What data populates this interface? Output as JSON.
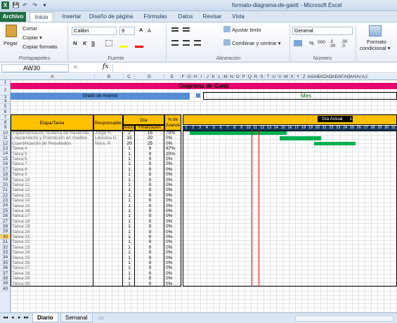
{
  "window": {
    "title": "formato-diagrama-de-gantt - Microsoft Excel"
  },
  "qat": {
    "logo": "X",
    "save": "💾",
    "undo": "↶",
    "redo": "↷",
    "more": "▾"
  },
  "ribbon_tabs": [
    "Archivo",
    "Inicio",
    "Insertar",
    "Diseño de página",
    "Fórmulas",
    "Datos",
    "Revisar",
    "Vista"
  ],
  "ribbon": {
    "paste": "Pegar",
    "cut": "Cortar",
    "copy": "Copiar ▾",
    "copy_format": "Copiar formato",
    "font_name": "Calibri",
    "font_size": "9",
    "wrap_text": "Ajustar texto",
    "merge_center": "Combinar y centrar ▾",
    "number_format": "General",
    "cond_format_1": "Formato",
    "cond_format_2": "condicional ▾",
    "group_clipboard": "Portapapeles",
    "group_font": "Fuente",
    "group_alignment": "Alineación",
    "group_number": "Número",
    "bold": "N",
    "italic": "K",
    "underline": "S",
    "grow_font": "A",
    "shrink_font": "A",
    "percent": "%",
    "thousands": "000",
    "dec_more": ",0 .00",
    "dec_less": ",00 ,0"
  },
  "formula_bar": {
    "name_box": "AW30",
    "fx": "fx",
    "value": ""
  },
  "columns": [
    "A",
    "B",
    "C",
    "D",
    "E",
    "F",
    "G",
    "H",
    "I",
    "J",
    "K",
    "L",
    "M",
    "N",
    "O",
    "P",
    "Q",
    "R",
    "S",
    "T",
    "U",
    "V",
    "W",
    "X",
    "Y",
    "Z",
    "AA",
    "AB",
    "AC",
    "AD",
    "AE",
    "AF",
    "AG",
    "AH",
    "AI",
    "AJ"
  ],
  "rows": [
    "1",
    "2",
    "3",
    "4",
    "5",
    "6",
    "7",
    "8",
    "9",
    "10",
    "11",
    "12",
    "13",
    "14",
    "15",
    "16",
    "17",
    "18",
    "19",
    "20",
    "21",
    "22",
    "23",
    "24",
    "25",
    "26",
    "27",
    "28",
    "29",
    "30",
    "31",
    "32",
    "33",
    "34",
    "35",
    "36",
    "37",
    "38",
    "39",
    "40"
  ],
  "sheet": {
    "title": "Diagrama de Gantt",
    "progress_label": "Grado de Avance",
    "month_label": "Mes",
    "col_task": "Etapa/Tarea",
    "col_owner": "Responsable",
    "col_day": "Día",
    "col_start": "Inicio",
    "col_end": "Finalización",
    "col_pct": "% de Avance",
    "current_day_label": "Día Actual",
    "current_day_value": "11",
    "days": [
      "1",
      "2",
      "3",
      "4",
      "5",
      "6",
      "7",
      "8",
      "9",
      "10",
      "11",
      "12",
      "13",
      "14",
      "15",
      "16",
      "17",
      "18",
      "19",
      "20",
      "21",
      "22",
      "23",
      "24",
      "25",
      "26",
      "27",
      "28",
      "29",
      "30",
      "31"
    ],
    "tasks": [
      {
        "name": "Implementación Sistema de Reservas",
        "owner": "Jorge R.",
        "start": "2",
        "end": "15",
        "pct": "70%"
      },
      {
        "name": "Lnazamiento y Promoción en medios",
        "owner": "Leonora G.",
        "start": "15",
        "end": "20",
        "pct": "0%"
      },
      {
        "name": "Cuantificación de Resultados",
        "owner": "Nora. R",
        "start": "20",
        "end": "25",
        "pct": "0%"
      },
      {
        "name": "Tarea 4",
        "owner": "",
        "start": "1",
        "end": "0",
        "pct": "67%"
      },
      {
        "name": "Tarea 5",
        "owner": "",
        "start": "1",
        "end": "0",
        "pct": "20%"
      },
      {
        "name": "Tarea 6",
        "owner": "",
        "start": "1",
        "end": "0",
        "pct": "0%"
      },
      {
        "name": "Tarea 7",
        "owner": "",
        "start": "1",
        "end": "0",
        "pct": "0%"
      },
      {
        "name": "Tarea 8",
        "owner": "",
        "start": "1",
        "end": "0",
        "pct": "0%"
      },
      {
        "name": "Tarea 9",
        "owner": "",
        "start": "1",
        "end": "0",
        "pct": "0%"
      },
      {
        "name": "Tarea 10",
        "owner": "",
        "start": "1",
        "end": "0",
        "pct": "0%"
      },
      {
        "name": "Tarea 11",
        "owner": "",
        "start": "1",
        "end": "0",
        "pct": "0%"
      },
      {
        "name": "Tarea 12",
        "owner": "",
        "start": "1",
        "end": "0",
        "pct": "0%"
      },
      {
        "name": "Tarea 13",
        "owner": "",
        "start": "1",
        "end": "0",
        "pct": "0%"
      },
      {
        "name": "Tarea 14",
        "owner": "",
        "start": "1",
        "end": "0",
        "pct": "0%"
      },
      {
        "name": "Tarea 15",
        "owner": "",
        "start": "1",
        "end": "0",
        "pct": "0%"
      },
      {
        "name": "Tarea 16",
        "owner": "",
        "start": "1",
        "end": "0",
        "pct": "0%"
      },
      {
        "name": "Tarea 17",
        "owner": "",
        "start": "1",
        "end": "0",
        "pct": "0%"
      },
      {
        "name": "Tarea 18",
        "owner": "",
        "start": "1",
        "end": "0",
        "pct": "0%"
      },
      {
        "name": "Tarea 19",
        "owner": "",
        "start": "1",
        "end": "0",
        "pct": "0%"
      },
      {
        "name": "Tarea 20",
        "owner": "",
        "start": "1",
        "end": "0",
        "pct": "0%"
      },
      {
        "name": "Tarea 21",
        "owner": "",
        "start": "1",
        "end": "0",
        "pct": "0%"
      },
      {
        "name": "Tarea 22",
        "owner": "",
        "start": "1",
        "end": "0",
        "pct": "0%"
      },
      {
        "name": "Tarea 23",
        "owner": "",
        "start": "1",
        "end": "0",
        "pct": "0%"
      },
      {
        "name": "Tarea 24",
        "owner": "",
        "start": "1",
        "end": "0",
        "pct": "0%"
      },
      {
        "name": "Tarea 25",
        "owner": "",
        "start": "1",
        "end": "0",
        "pct": "0%"
      },
      {
        "name": "Tarea 26",
        "owner": "",
        "start": "1",
        "end": "0",
        "pct": "0%"
      },
      {
        "name": "Tarea 27",
        "owner": "",
        "start": "1",
        "end": "0",
        "pct": "0%"
      },
      {
        "name": "Tarea 28",
        "owner": "",
        "start": "1",
        "end": "0",
        "pct": "0%"
      },
      {
        "name": "Tarea 29",
        "owner": "",
        "start": "1",
        "end": "0",
        "pct": "0%"
      },
      {
        "name": "Tarea 30",
        "owner": "",
        "start": "1",
        "end": "0",
        "pct": "0%"
      }
    ],
    "colors": {
      "title_bg": "#e8006e",
      "header_bg": "#ffc000",
      "progress_bg": "#558ed5",
      "bar": "#00b050",
      "today_line": "#ff0000",
      "day_header_bg": "#17375e"
    }
  },
  "sheet_tabs": [
    "Diario",
    "Semanal"
  ],
  "sheet_nav": [
    "◂◂",
    "◂",
    "▸",
    "▸▸"
  ]
}
